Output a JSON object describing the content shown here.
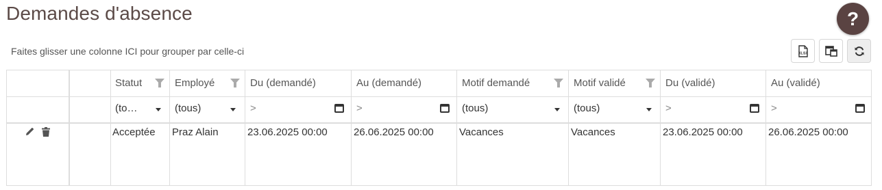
{
  "page": {
    "title": "Demandes d'absence",
    "help_label": "?",
    "group_hint": "Faites glisser une colonne ICI pour grouper par celle-ci"
  },
  "toolbar": {
    "export_icon": "xlsx-export-icon",
    "columns_icon": "column-chooser-icon",
    "refresh_icon": "refresh-icon"
  },
  "grid": {
    "headers": {
      "statut": "Statut",
      "employe": "Employé",
      "du_demande": "Du (demandé)",
      "au_demande": "Au (demandé)",
      "motif_demande": "Motif demandé",
      "motif_valide": "Motif validé",
      "du_valide": "Du (validé)",
      "au_valide": "Au (validé)"
    },
    "filters": {
      "statut": "(to…",
      "employe": "(tous)",
      "du_demande": ">",
      "au_demande": ">",
      "motif_demande": "(tous)",
      "motif_valide": "(tous)",
      "du_valide": ">",
      "au_valide": ">"
    },
    "rows": [
      {
        "statut": "Acceptée",
        "employe": "Praz Alain",
        "du_demande": "23.06.2025 00:00",
        "au_demande": "26.06.2025 00:00",
        "motif_demande": "Vacances",
        "motif_valide": "Vacances",
        "du_valide": "23.06.2025 00:00",
        "au_valide": "26.06.2025 00:00"
      }
    ]
  }
}
